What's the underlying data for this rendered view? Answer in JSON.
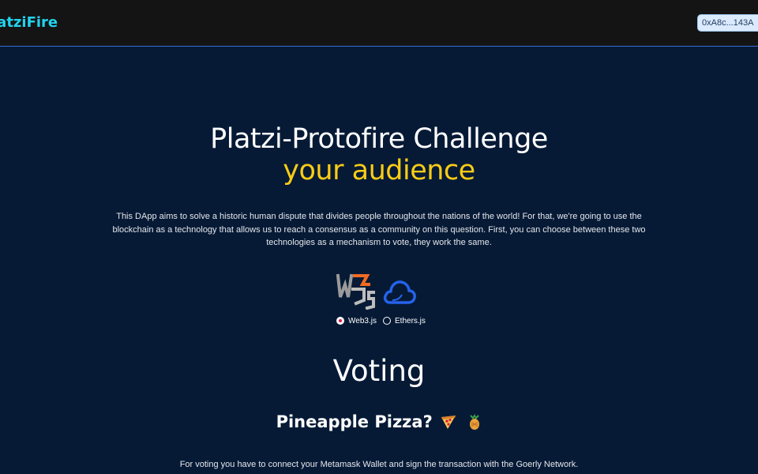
{
  "navbar": {
    "brand": "latziFire",
    "wallet_label": "0xA8c...143A"
  },
  "hero": {
    "title": "Platzi-Protofire Challenge",
    "subtitle": "your audience",
    "description": "This DApp aims to solve a historic human dispute that divides people throughout the nations of the world! For that, we're going to use the blockchain as a technology that allows us to reach a consensus as a community on this question. First, you can choose between these two technologies as a mechanism to vote, they work the same."
  },
  "libraries": {
    "options": [
      {
        "label": "Web3.js",
        "selected": true,
        "icon": "web3js-logo"
      },
      {
        "label": "Ethers.js",
        "selected": false,
        "icon": "ethers-logo"
      }
    ]
  },
  "voting": {
    "heading": "Voting",
    "question": "Pineapple Pizza?",
    "question_icons": [
      "pizza-emoji",
      "pineapple-emoji"
    ],
    "instructions": "For voting you have to connect your Metamask Wallet and sign the transaction with the Goerly Network."
  },
  "colors": {
    "background": "#061a36",
    "navbar": "#141414",
    "brand": "#22d3ee",
    "accent_yellow": "#facc15",
    "radio_selected": "#e11d48"
  }
}
